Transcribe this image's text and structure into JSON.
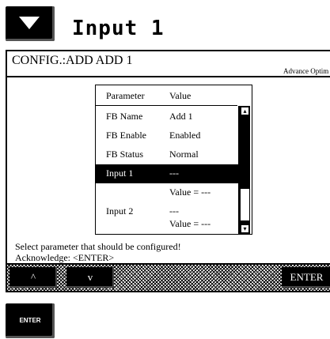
{
  "header": {
    "title": "Input 1",
    "icon": "chevron-down-icon"
  },
  "screen": {
    "title": "CONFIG.:ADD ADD 1",
    "tag": "Advance Optim",
    "table": {
      "headers": {
        "parameter": "Parameter",
        "value": "Value"
      },
      "rows": [
        {
          "param": "FB Name",
          "value": "Add 1"
        },
        {
          "param": "FB Enable",
          "value": "Enabled"
        },
        {
          "param": "FB Status",
          "value": "Normal"
        },
        {
          "param": "Input 1",
          "value": "---",
          "selected": true
        },
        {
          "param": "",
          "value": "Value = ---"
        },
        {
          "param": "Input 2",
          "value": "---"
        },
        {
          "param": "",
          "value": "Value = ---"
        }
      ]
    },
    "message_line1": "Select parameter that should be configured!",
    "message_line2": "Acknowledge: <ENTER>",
    "softkeys": {
      "up": "^",
      "down": "v",
      "enter": "ENTER"
    }
  },
  "hardware_button": {
    "label": "ENTER"
  }
}
